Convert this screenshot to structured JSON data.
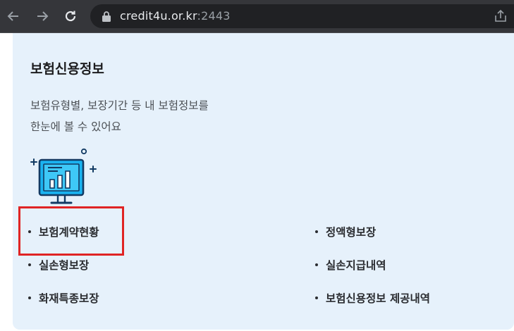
{
  "browser": {
    "url_host": "credit4u.or.kr",
    "url_port": ":2443",
    "icons": {
      "back": "arrow-left-icon",
      "forward": "arrow-right-icon",
      "reload": "reload-icon",
      "lock": "lock-icon",
      "share": "share-icon"
    }
  },
  "card": {
    "title": "보험신용정보",
    "desc_line1": "보험유형별, 보장기간 등 내 보험정보를",
    "desc_line2": "한눈에 볼 수 있어요",
    "illustration": "monitor-chart-icon",
    "menu": [
      {
        "label": "보험계약현황"
      },
      {
        "label": "정액형보장"
      },
      {
        "label": "실손형보장"
      },
      {
        "label": "실손지급내역"
      },
      {
        "label": "화재특종보장"
      },
      {
        "label": "보험신용정보 제공내역"
      }
    ]
  },
  "colors": {
    "card_bg": "#e6f1fb",
    "highlight": "#e02424",
    "icon_blue": "#1ab3f0",
    "icon_navy": "#123a63"
  }
}
